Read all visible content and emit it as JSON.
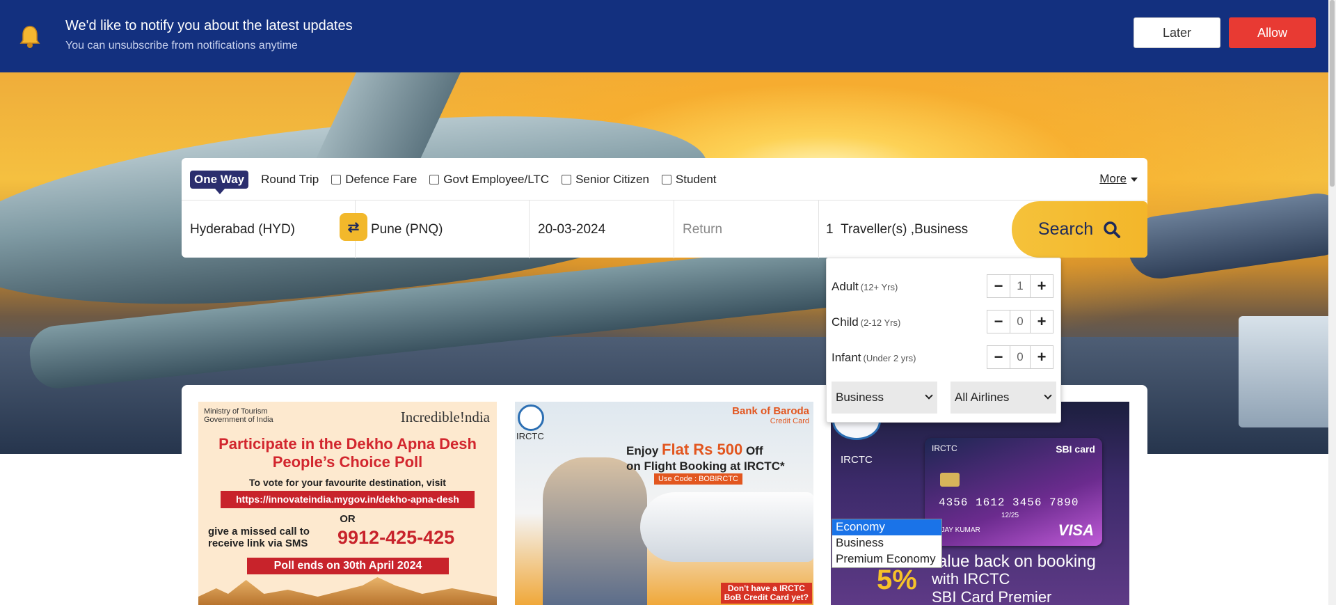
{
  "notification": {
    "title": "We'd like to notify you about the latest updates",
    "subtitle": "You can unsubscribe from notifications anytime",
    "later_label": "Later",
    "allow_label": "Allow",
    "bell_icon": "bell-icon"
  },
  "search": {
    "trip_types": {
      "one_way": "One Way",
      "round_trip": "Round Trip"
    },
    "fare_options": [
      {
        "label": "Defence Fare",
        "checked": false
      },
      {
        "label": "Govt Employee/LTC",
        "checked": false
      },
      {
        "label": "Senior Citizen",
        "checked": false
      },
      {
        "label": "Student",
        "checked": false
      }
    ],
    "more_label": "More",
    "from": "Hyderabad (HYD)",
    "to": "Pune (PNQ)",
    "departure": "20-03-2024",
    "return_placeholder": "Return",
    "traveller_count": "1",
    "traveller_summary": "Traveller(s) ,Business",
    "search_label": "Search",
    "swap_icon": "swap-icon"
  },
  "travellers": {
    "rows": [
      {
        "label": "Adult",
        "note": "(12+ Yrs)",
        "value": "1"
      },
      {
        "label": "Child",
        "note": "(2-12 Yrs)",
        "value": "0"
      },
      {
        "label": "Infant",
        "note": "(Under 2 yrs)",
        "value": "0"
      }
    ],
    "class_selected": "Business",
    "airline_selected": "All Airlines",
    "class_options": [
      "Economy",
      "Business",
      "Premium Economy"
    ]
  },
  "cards": {
    "tourism": {
      "ministry": "Ministry of Tourism Government of India",
      "brand": "Incredible!ndia",
      "headline_1": "Participate in the Dekho Apna Desh",
      "headline_2": "People’s Choice Poll",
      "prompt": "To vote for your favourite destination, visit",
      "url": "https://innovateindia.mygov.in/dekho-apna-desh",
      "or": "OR",
      "call_1": "give a missed call to",
      "call_2": "receive link via SMS",
      "phone": "9912-425-425",
      "poll_end": "Poll ends on 30th April 2024"
    },
    "bob": {
      "irctc": "IRCTC",
      "bank": "Bank of Baroda",
      "bank_sub": "Credit Card",
      "offer_1": "Enjoy",
      "offer_big": "Flat Rs 500",
      "offer_2": "Off",
      "offer_3": "on Flight Booking at IRCTC*",
      "code": "Use Code : BOBIRCTC",
      "tag_1": "Don't have a IRCTC",
      "tag_2": "BoB Credit Card yet?"
    },
    "sbi": {
      "irctc": "IRCTC",
      "card_brand_left": "IRCTC",
      "card_brand_right": "SBI card",
      "number": "4356 1612 3456 7890",
      "expiry": "12/25",
      "holder": "VIJAY KUMAR",
      "network": "VISA",
      "pct": "5%",
      "line_1": "value back on booking",
      "line_2": "with IRCTC",
      "line_3": "SBI Card Premier"
    }
  }
}
